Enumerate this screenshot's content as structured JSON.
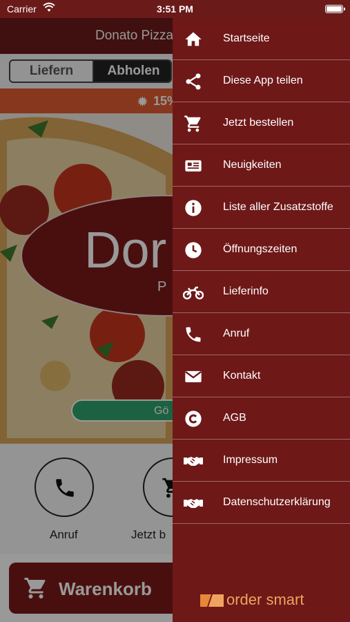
{
  "status_bar": {
    "carrier": "Carrier",
    "time": "3:51 PM"
  },
  "app": {
    "title": "Donato Pizza",
    "segment": {
      "options": [
        "Liefern",
        "Abholen"
      ],
      "selected": "Abholen"
    },
    "promo": "15%",
    "logo": {
      "big": "Dor",
      "small": "PI"
    },
    "status_pill": "Gö",
    "actions": [
      {
        "label": "Anruf",
        "icon": "phone-icon"
      },
      {
        "label": "Jetzt b",
        "icon": "cart-icon"
      }
    ],
    "cart_label": "Warenkorb"
  },
  "drawer": {
    "items": [
      {
        "label": "Startseite",
        "icon": "home-icon"
      },
      {
        "label": "Diese App teilen",
        "icon": "share-icon"
      },
      {
        "label": "Jetzt bestellen",
        "icon": "cart-icon"
      },
      {
        "label": "Neuigkeiten",
        "icon": "news-icon"
      },
      {
        "label": "Liste aller Zusatzstoffe",
        "icon": "info-icon"
      },
      {
        "label": "Öffnungszeiten",
        "icon": "clock-icon"
      },
      {
        "label": "Lieferinfo",
        "icon": "motorbike-icon"
      },
      {
        "label": "Anruf",
        "icon": "phone-icon"
      },
      {
        "label": "Kontakt",
        "icon": "envelope-icon"
      },
      {
        "label": "AGB",
        "icon": "copyright-icon"
      },
      {
        "label": "Impressum",
        "icon": "handshake-icon"
      },
      {
        "label": "Datenschutzerklärung",
        "icon": "handshake-icon"
      }
    ],
    "brand": "order smart"
  },
  "colors": {
    "header": "#6b1a1a",
    "drawer": "#6e1818",
    "promo": "#e25c33",
    "status_open": "#2fa36b",
    "brand_orange": "#f0a35e"
  }
}
